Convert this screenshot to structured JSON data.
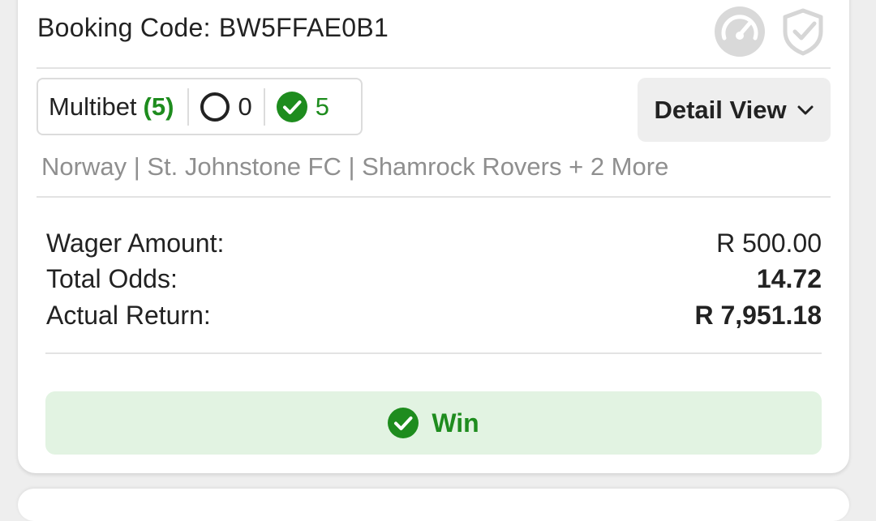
{
  "booking": {
    "label": "Booking Code:",
    "code": "BW5FFAE0B1"
  },
  "header_icons": {
    "speed": "speedometer-icon",
    "shield": "shield-check-icon"
  },
  "multibet": {
    "label": "Multibet",
    "count": "(5)",
    "pending_count": "0",
    "won_count": "5"
  },
  "detail_view": {
    "label": "Detail View",
    "icon": "chevron-down-icon"
  },
  "teams": "Norway | St. Johnstone FC | Shamrock Rovers + 2 More",
  "summary": {
    "wager_label": "Wager Amount:",
    "wager_value": "R 500.00",
    "odds_label": "Total Odds:",
    "odds_value": "14.72",
    "return_label": "Actual Return:",
    "return_value": "R 7,951.18"
  },
  "result": {
    "label": "Win",
    "icon": "check-circle-icon"
  },
  "colors": {
    "green": "#1e8c1e",
    "win_bg": "#e2f3e2",
    "muted": "#8f8f8f"
  }
}
